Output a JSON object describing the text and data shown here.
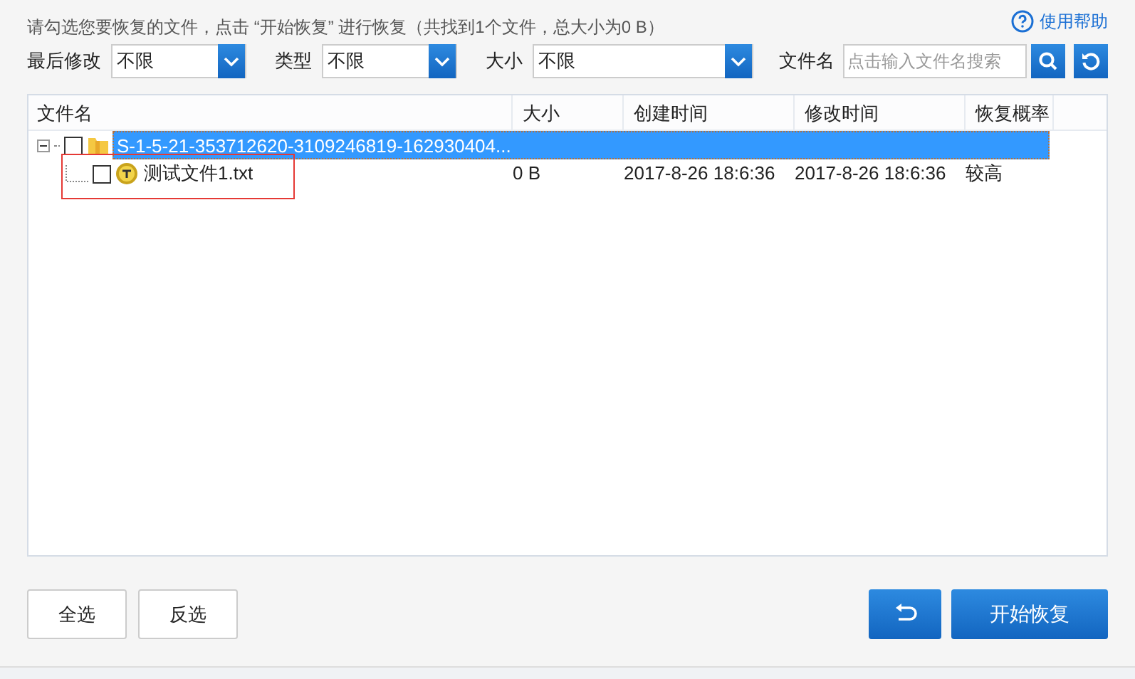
{
  "instruction": "请勾选您要恢复的文件，点击 “开始恢复” 进行恢复（共找到1个文件，总大小为0 B）",
  "help_link": "使用帮助",
  "filters": [
    {
      "label": "最后修改",
      "value": "不限"
    },
    {
      "label": "类型",
      "value": "不限"
    },
    {
      "label": "大小",
      "value": "不限"
    }
  ],
  "search": {
    "label": "文件名",
    "placeholder": "点击输入文件名搜索"
  },
  "table": {
    "columns": [
      "文件名",
      "大小",
      "创建时间",
      "修改时间",
      "恢复概率"
    ],
    "rows": [
      {
        "kind": "folder",
        "name": "S-1-5-21-353712620-3109246819-162930404...",
        "checked": false,
        "selected": true,
        "expanded": true,
        "children": [
          {
            "kind": "file",
            "name": "测试文件1.txt",
            "size": "0 B",
            "created": "2017-8-26 18:6:36",
            "modified": "2017-8-26 18:6:36",
            "rate": "较高",
            "checked": false,
            "selected": false
          }
        ]
      }
    ]
  },
  "buttons": {
    "select_all": "全选",
    "invert": "反选",
    "start": "开始恢复"
  }
}
